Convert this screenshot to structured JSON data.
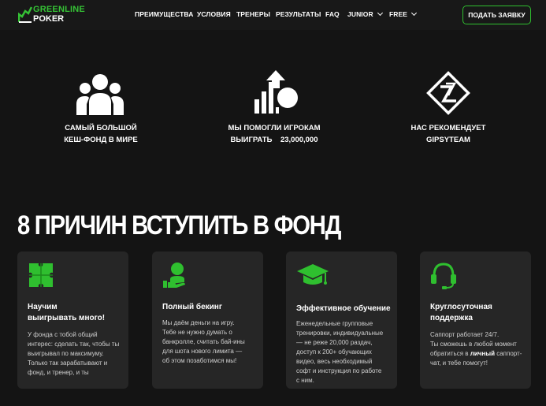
{
  "header": {
    "logo_top": "GREENLINE",
    "logo_bottom": "POKER",
    "nav": [
      {
        "label": "ПРЕИМУЩЕСТВА"
      },
      {
        "label": "УСЛОВИЯ"
      },
      {
        "label": "ТРЕНЕРЫ"
      },
      {
        "label": "РЕЗУЛЬТАТЫ"
      },
      {
        "label": "FAQ"
      },
      {
        "label": "JUNIOR"
      },
      {
        "label": "FREE"
      }
    ],
    "cta": "ПОДАТЬ ЗАЯВКУ"
  },
  "features": [
    {
      "icon": "users-group-icon",
      "lines": [
        "САМЫЙ БОЛЬШОЙ",
        "КЕШ-ФОНД В МИРЕ"
      ]
    },
    {
      "icon": "growth-chart-icon",
      "lines": [
        "МЫ ПОМОГЛИ ИГРОКАМ",
        "ВЫИГРАТЬ    23,000,000"
      ]
    },
    {
      "icon": "gipsyteam-logo-icon",
      "lines": [
        "НАС РЕКОМЕНДУЕТ",
        "GIPSYTEAM"
      ]
    }
  ],
  "section_title": "8 ПРИЧИН ВСТУПИТЬ В ФОНД",
  "cards": [
    {
      "icon": "puzzle-icon",
      "title": [
        "Научим",
        "выигрывать много!"
      ],
      "text": [
        "У фонда с тобой общий",
        "интерес: сделать так, чтобы ты",
        "выигрывал по максимуму.",
        "Только так зарабатывают и",
        "фонд, и тренер, и ты"
      ]
    },
    {
      "icon": "person-hand-icon",
      "title": [
        "Полный бекинг"
      ],
      "text": [
        "Мы даём деньги на игру.",
        "Тебе не нужно думать о",
        "банкролле, считать бай-ины",
        "для шота нового лимита —",
        "об этом позаботимся мы!"
      ]
    },
    {
      "icon": "graduation-cap-icon",
      "title": [
        "Эффективное обучение"
      ],
      "text": [
        "Еженедельные групповые",
        "тренировки, индивидуальные",
        "— не реже 20,000 раздач,",
        "доступ к 200+ обучающих",
        "видео, весь необходимый",
        "софт и инструкция по работе",
        "с ним."
      ]
    },
    {
      "icon": "headset-icon",
      "title": [
        "Круглосуточная",
        "поддержка"
      ],
      "text_a": "Саппорт работает 24/7.",
      "text_b": "Ты сможешь в любой момент",
      "text_c": "обратиться в",
      "text_d": "личный",
      "text_e": "саппорт-",
      "text_f": "чат, и тебе помогут!"
    }
  ],
  "colors": {
    "accent": "#2fbf2f",
    "background": "#141414",
    "card": "#262626"
  }
}
